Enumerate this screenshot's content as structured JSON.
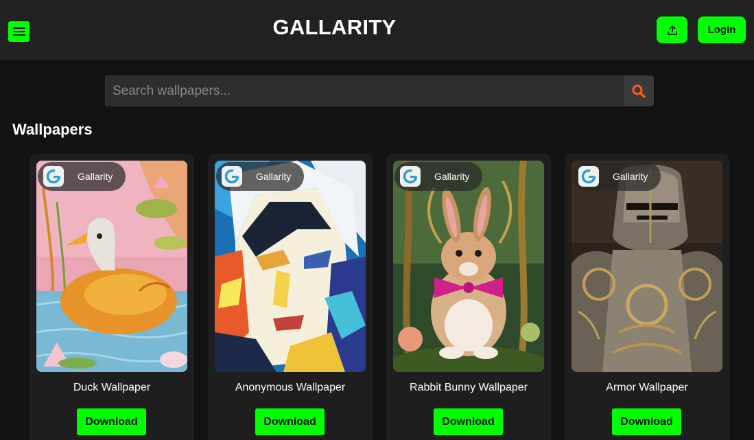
{
  "header": {
    "brand": "GALLARITY",
    "login_label": "LogIn",
    "menu_icon": "hamburger-menu-icon",
    "upload_icon": "upload-icon"
  },
  "search": {
    "placeholder": "Search wallpapers...",
    "value": "",
    "icon": "search-icon"
  },
  "section": {
    "title": "Wallpapers"
  },
  "colors": {
    "accent": "#00ff00",
    "header_bg": "#212121",
    "page_bg": "#121212",
    "card_bg": "#1e1e1e",
    "search_icon": "#ff5722"
  },
  "cards": [
    {
      "badge": "Gallarity",
      "title": "Duck Wallpaper",
      "download_label": "Download"
    },
    {
      "badge": "Gallarity",
      "title": "Anonymous Wallpaper",
      "download_label": "Download"
    },
    {
      "badge": "Gallarity",
      "title": "Rabbit Bunny Wallpaper",
      "download_label": "Download"
    },
    {
      "badge": "Gallarity",
      "title": "Armor Wallpaper",
      "download_label": "Download"
    }
  ]
}
